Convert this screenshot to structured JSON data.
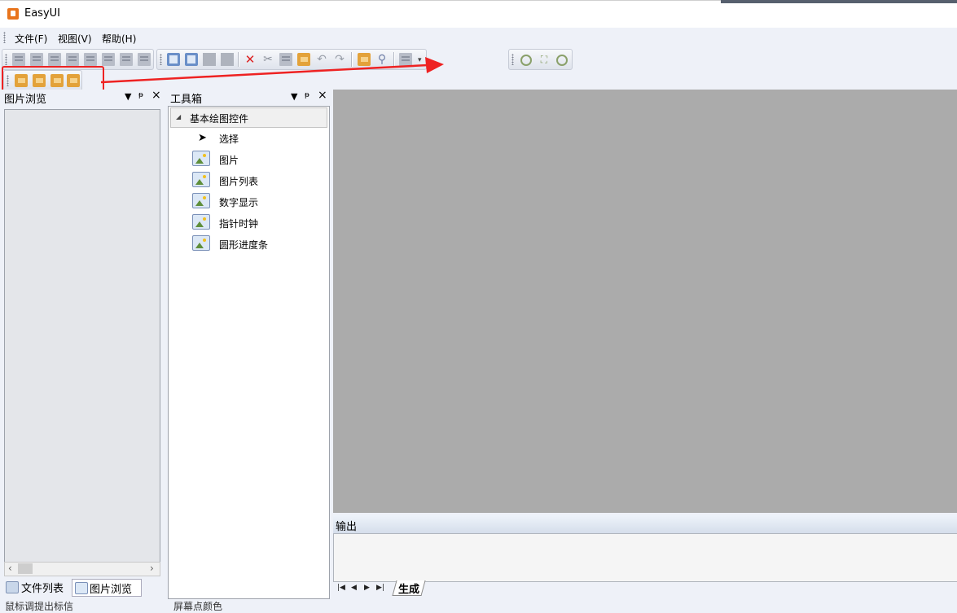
{
  "app": {
    "title": "EasyUI"
  },
  "menu": [
    {
      "label": "文件(F)"
    },
    {
      "label": "视图(V)"
    },
    {
      "label": "帮助(H)"
    }
  ],
  "left_panel": {
    "title": "图片浏览",
    "tabs": [
      {
        "label": "文件列表"
      },
      {
        "label": "图片浏览"
      }
    ]
  },
  "toolbox": {
    "title": "工具箱",
    "group": "基本绘图控件",
    "items": [
      {
        "label": "选择",
        "icon": "pointer-icon"
      },
      {
        "label": "图片",
        "icon": "image-icon"
      },
      {
        "label": "图片列表",
        "icon": "image-icon"
      },
      {
        "label": "数字显示",
        "icon": "image-icon"
      },
      {
        "label": "指针时钟",
        "icon": "image-icon"
      },
      {
        "label": "圆形进度条",
        "icon": "image-icon"
      }
    ]
  },
  "output": {
    "title": "输出",
    "tab": "生成"
  },
  "status": {
    "left": "鼠标调提出标信",
    "right": "屏幕点颜色"
  },
  "panel_buttons": {
    "dropdown": "▼",
    "pin": "📌",
    "close": "×"
  },
  "colors": {
    "annotation": "#ee2222",
    "canvas": "#ababab",
    "background": "#eef1f8"
  }
}
